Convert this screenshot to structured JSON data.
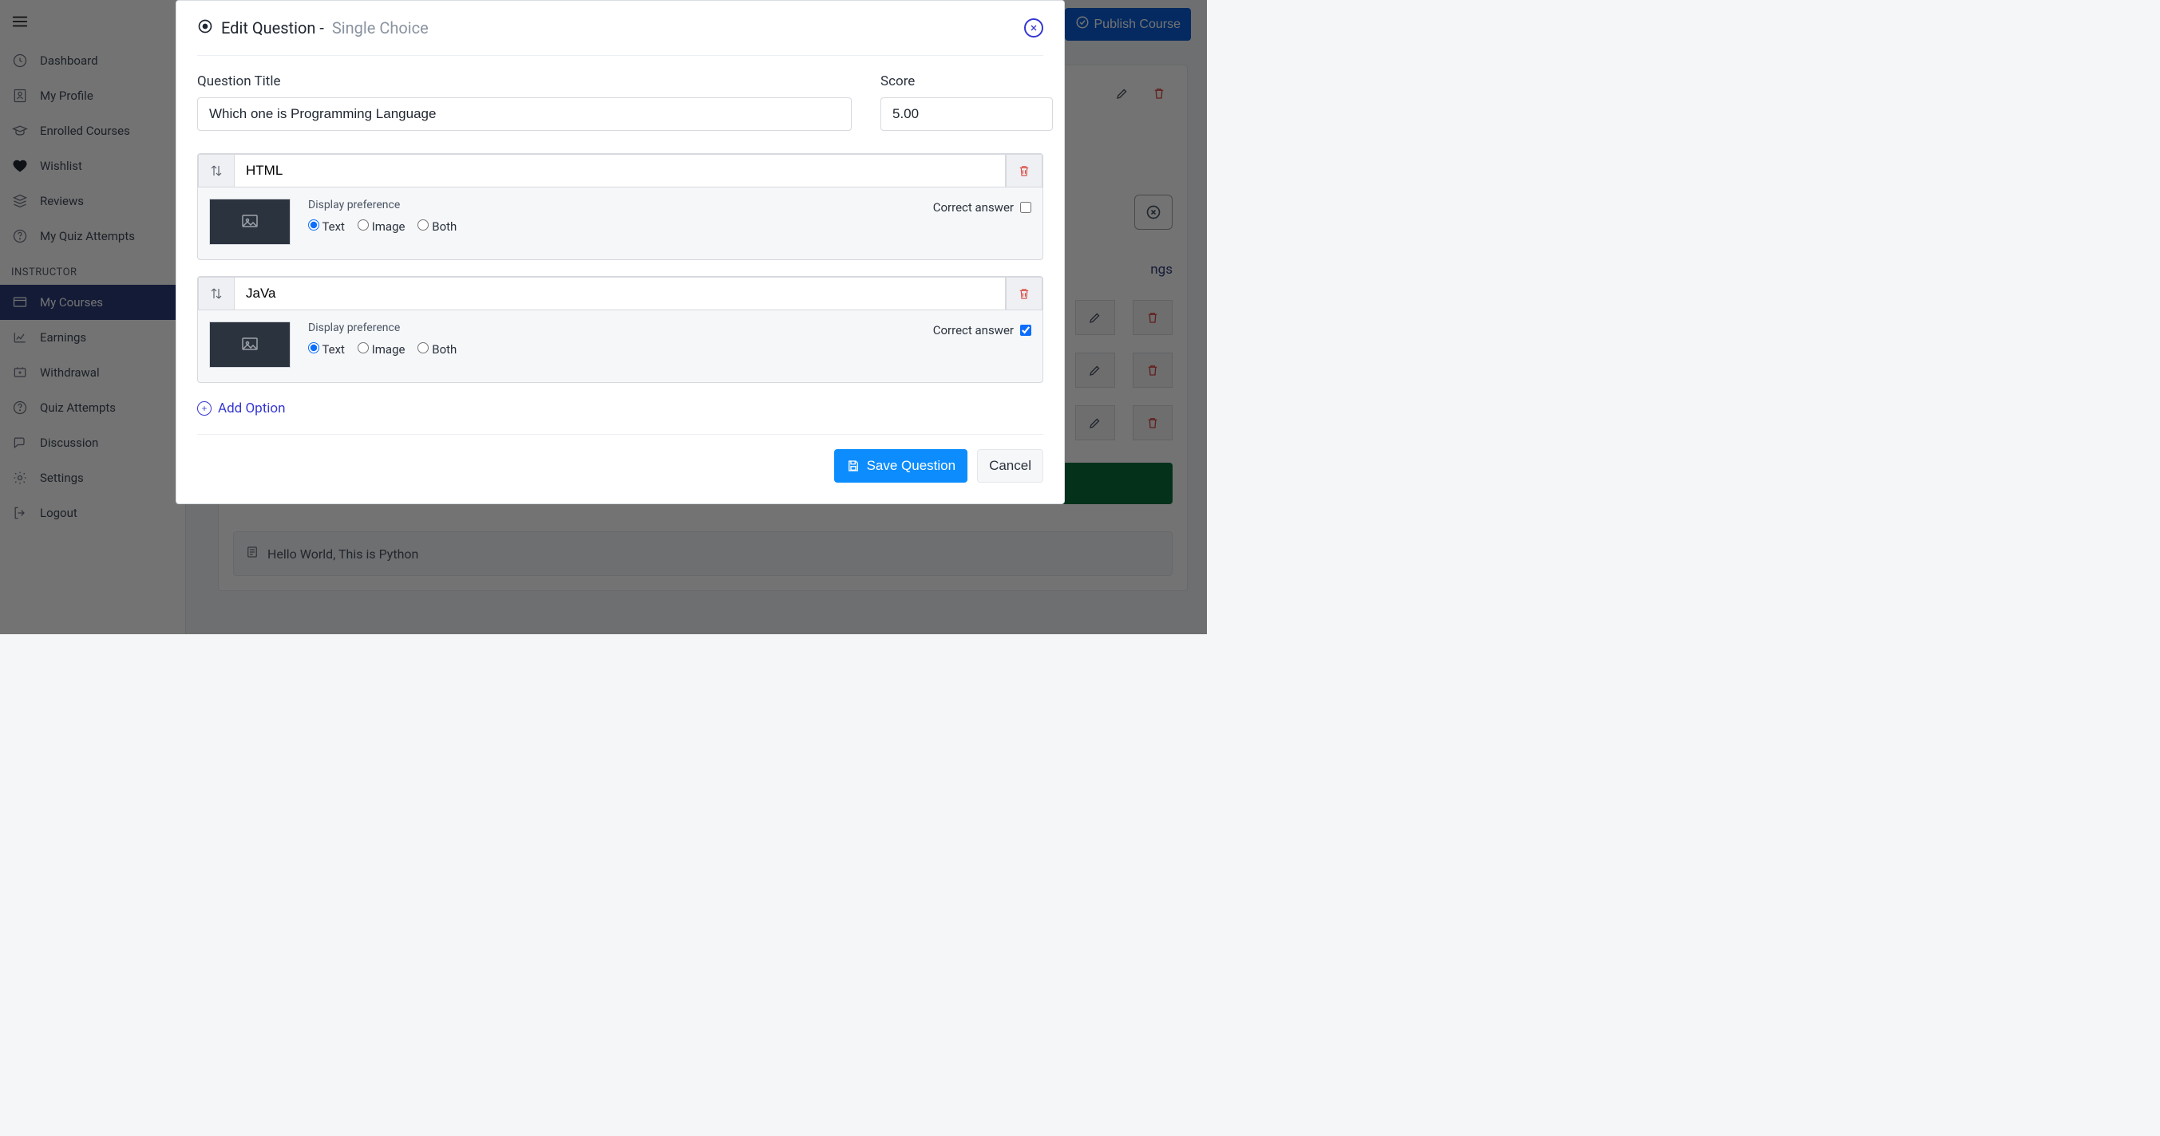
{
  "sidebar": {
    "section_instructor": "INSTRUCTOR",
    "items": {
      "dashboard": "Dashboard",
      "profile": "My Profile",
      "enrolled": "Enrolled Courses",
      "wishlist": "Wishlist",
      "reviews": "Reviews",
      "quiz_attempts": "My Quiz Attempts",
      "my_courses": "My Courses",
      "earnings": "Earnings",
      "withdrawal": "Withdrawal",
      "inst_quiz_attempts": "Quiz Attempts",
      "discussion": "Discussion",
      "settings": "Settings",
      "logout": "Logout"
    }
  },
  "header": {
    "publish_label": "Publish Course"
  },
  "content": {
    "tabs": {
      "ings": "ngs"
    },
    "lesson_row": "Hello World, This is Python"
  },
  "modal": {
    "title_strong": "Edit Question -",
    "title_muted": "Single Choice",
    "labels": {
      "question_title": "Question Title",
      "score": "Score",
      "display_preference": "Display preference",
      "correct_answer": "Correct answer",
      "text": "Text",
      "image": "Image",
      "both": "Both",
      "add_option": "Add Option"
    },
    "question_title_value": "Which one is Programming Language",
    "score_value": "5.00",
    "options": [
      {
        "text": "HTML",
        "display": "text",
        "correct": false
      },
      {
        "text": "JaVa",
        "display": "text",
        "correct": true
      }
    ],
    "footer": {
      "save": "Save Question",
      "cancel": "Cancel"
    }
  }
}
